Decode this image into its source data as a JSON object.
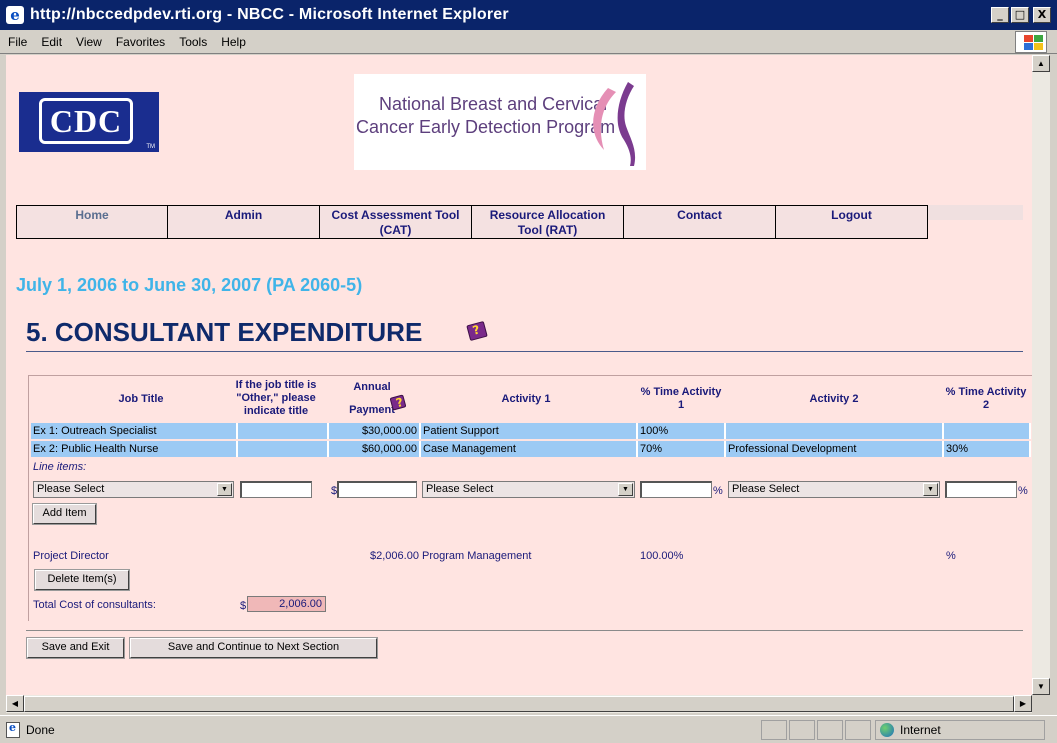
{
  "window": {
    "title": "http://nbccedpdev.rti.org - NBCC - Microsoft Internet Explorer",
    "min_label": "_",
    "max_label": "□",
    "close_label": "X"
  },
  "menu": [
    "File",
    "Edit",
    "View",
    "Favorites",
    "Tools",
    "Help"
  ],
  "logos": {
    "cdc": "CDC",
    "cdc_tm": "TM",
    "nbcc_line1": "National Breast and Cervical",
    "nbcc_line2": "Cancer Early Detection Program"
  },
  "nav": {
    "home": "Home",
    "admin": "Admin",
    "cat_line1": "Cost Assessment Tool",
    "cat_line2": "(CAT)",
    "rat_line1": "Resource Allocation",
    "rat_line2": "Tool (RAT)",
    "contact": "Contact",
    "logout": "Logout"
  },
  "period": "July 1, 2006 to June 30, 2007 (PA 2060-5)",
  "section_title": "5. CONSULTANT EXPENDITURE",
  "table": {
    "headers": {
      "job_title": "Job Title",
      "other_title_l1": "If the job title is",
      "other_title_l2": "\"Other,\" please",
      "other_title_l3": "indicate title",
      "annual_l1": "Annual",
      "annual_l2": "Payment",
      "activity1": "Activity 1",
      "pct1_l1": "% Time Activity",
      "pct1_l2": "1",
      "activity2": "Activity 2",
      "pct2_l1": "% Time Activity",
      "pct2_l2": "2"
    },
    "examples": [
      {
        "job": "Ex 1: Outreach Specialist",
        "other": "",
        "payment": "$30,000.00",
        "activity1": "Patient Support",
        "pct1": "100%",
        "activity2": "",
        "pct2": ""
      },
      {
        "job": "Ex 2: Public Health Nurse",
        "other": "",
        "payment": "$60,000.00",
        "activity1": "Case Management",
        "pct1": "70%",
        "activity2": "Professional Development",
        "pct2": "30%"
      }
    ],
    "line_items_label": "Line items:",
    "new_row": {
      "job_select": "Please Select",
      "dollar": "$",
      "activity1_select": "Please Select",
      "pct_sign": "%",
      "activity2_select": "Please Select",
      "pct_sign2": "%"
    },
    "add_item": "Add Item",
    "saved_row": {
      "job": "Project Director",
      "payment": "$2,006.00",
      "activity1": "Program Management",
      "pct1": "100.00%",
      "pct2": "%"
    },
    "delete_items": "Delete Item(s)",
    "total_label": "Total Cost of consultants:",
    "total_dollar": "$",
    "total_value": "2,006.00"
  },
  "buttons": {
    "save_exit": "Save and Exit",
    "save_continue": "Save and Continue to Next Section"
  },
  "status": {
    "text": "Done",
    "zone": "Internet"
  }
}
